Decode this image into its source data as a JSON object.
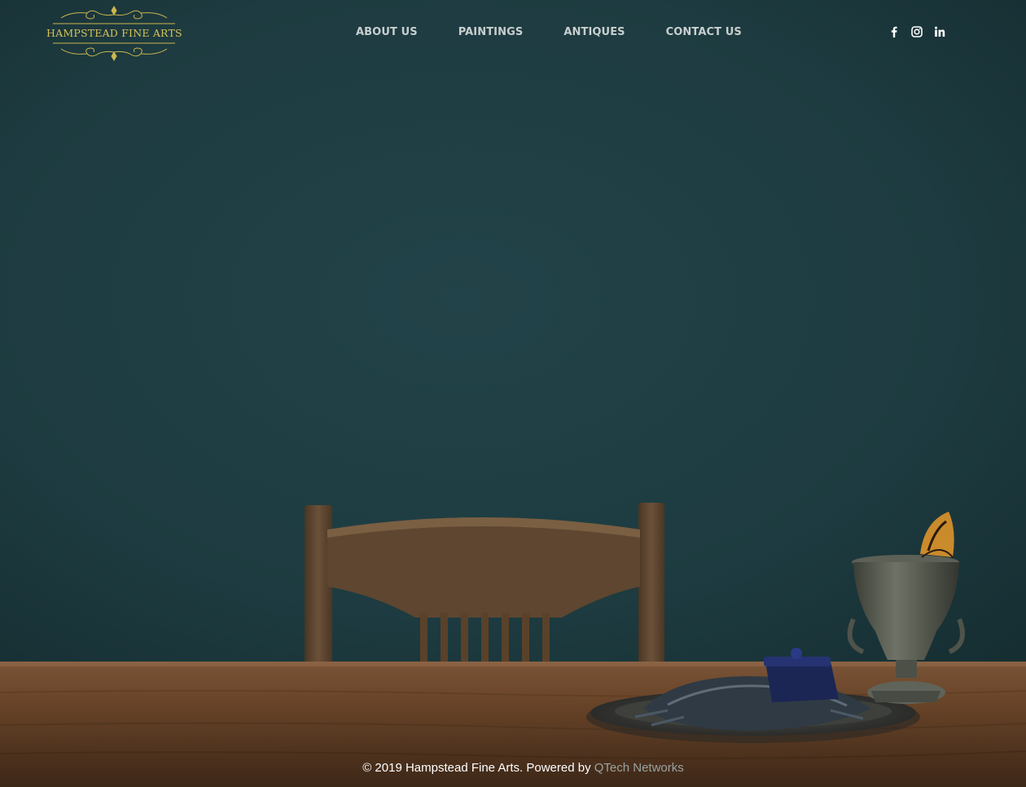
{
  "brand": {
    "logo_text": "HAMPSTEAD FINE ARTS",
    "logo_color": "#d6c35a"
  },
  "nav": {
    "items": [
      {
        "label": "ABOUT US"
      },
      {
        "label": "PAINTINGS"
      },
      {
        "label": "ANTIQUES"
      },
      {
        "label": "CONTACT US"
      }
    ]
  },
  "social": {
    "icons": [
      "facebook-icon",
      "instagram-icon",
      "linkedin-icon"
    ]
  },
  "footer": {
    "copyright": "© 2019 Hampstead Fine Arts. Powered by ",
    "powered_link": "QTech Networks"
  },
  "colors": {
    "wall": "#1c3a3e",
    "table": "#6b4a30",
    "nav_text": "#c9cfcf"
  }
}
